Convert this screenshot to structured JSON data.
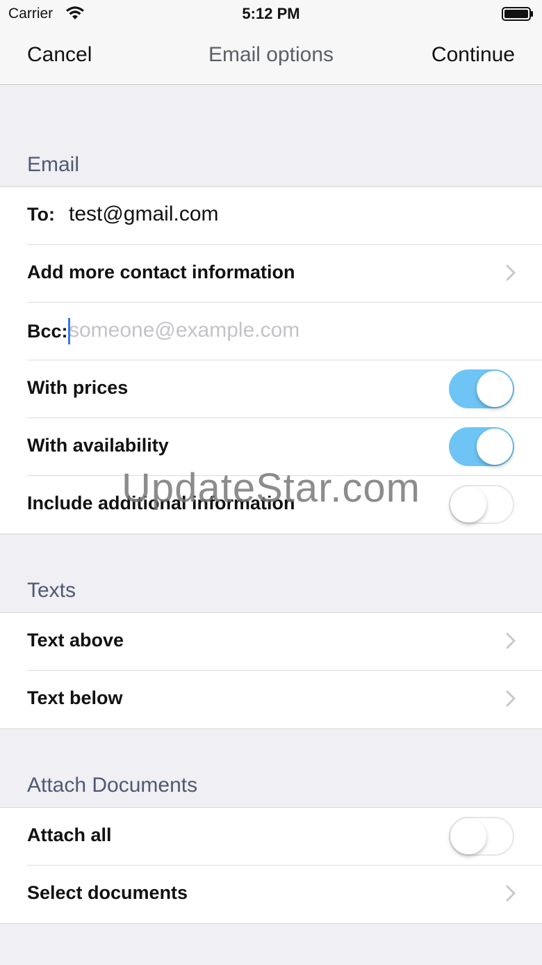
{
  "status_bar": {
    "carrier": "Carrier",
    "time": "5:12 PM",
    "wifi_icon": "wifi-icon",
    "battery_icon": "battery-icon"
  },
  "nav": {
    "left": "Cancel",
    "title": "Email options",
    "right": "Continue"
  },
  "email_section": {
    "header": "Email",
    "to_label": "To:",
    "to_value": "test@gmail.com",
    "add_contact_label": "Add more contact information",
    "bcc_label": "Bcc:",
    "bcc_placeholder": "someone@example.com",
    "bcc_value": "",
    "with_prices_label": "With prices",
    "with_prices_on": true,
    "with_availability_label": "With availability",
    "with_availability_on": true,
    "additional_info_label": "Include additional information",
    "additional_info_on": false
  },
  "texts_section": {
    "header": "Texts",
    "text_above_label": "Text above",
    "text_below_label": "Text below"
  },
  "documents_section": {
    "header": "Attach Documents",
    "attach_all_label": "Attach all",
    "attach_all_on": false,
    "select_documents_label": "Select documents"
  },
  "watermark": "UpdateStar.com",
  "colors": {
    "toggle_on": "#6ec4f5",
    "caret": "#3478f6",
    "section_header": "#4f5970",
    "background": "#efeff4"
  }
}
